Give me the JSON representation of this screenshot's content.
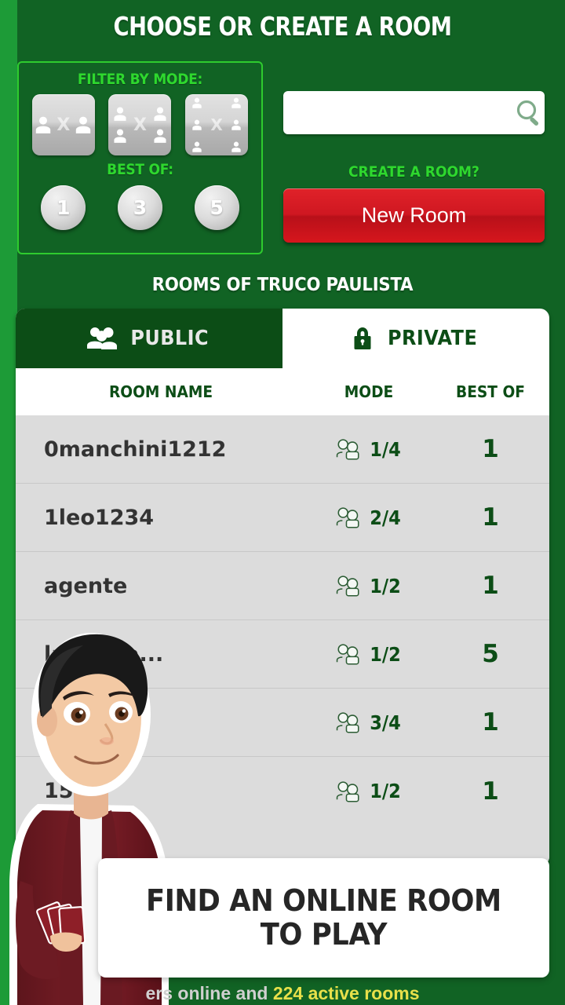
{
  "header": {
    "title": "CHOOSE OR CREATE A ROOM"
  },
  "filter_panel": {
    "mode_label": "FILTER BY MODE:",
    "best_of_label": "BEST OF:",
    "modes": [
      {
        "name": "mode-1v1",
        "players_per_side": 1
      },
      {
        "name": "mode-2v2",
        "players_per_side": 2
      },
      {
        "name": "mode-3v3",
        "players_per_side": 3
      }
    ],
    "best_of_options": [
      "1",
      "3",
      "5"
    ]
  },
  "search": {
    "value": "",
    "placeholder": "",
    "icon": "search-icon"
  },
  "create": {
    "question_label": "CREATE A ROOM?",
    "button_label": "New Room"
  },
  "section": {
    "title": "ROOMS OF TRUCO PAULISTA"
  },
  "tabs": [
    {
      "label": "PUBLIC",
      "icon": "people-icon",
      "active": true
    },
    {
      "label": "PRIVATE",
      "icon": "lock-icon",
      "active": false
    }
  ],
  "table": {
    "columns": [
      "ROOM NAME",
      "MODE",
      "BEST OF"
    ],
    "rows": [
      {
        "name": "0manchini1212",
        "mode": "1/4",
        "best_of": "1"
      },
      {
        "name": "1leo1234",
        "mode": "2/4",
        "best_of": "1"
      },
      {
        "name": "agente",
        "mode": "1/2",
        "best_of": "1"
      },
      {
        "name": "laminha...",
        "mode": "1/2",
        "best_of": "5"
      },
      {
        "name": "",
        "mode": "3/4",
        "best_of": "1"
      },
      {
        "name": "1545",
        "mode": "1/2",
        "best_of": "1"
      }
    ]
  },
  "tooltip": {
    "line1": "FIND AN ONLINE ROOM",
    "line2": "TO PLAY"
  },
  "status": {
    "prefix": "ers online and ",
    "rooms_count": "224",
    "suffix": " active rooms"
  },
  "colors": {
    "background_green": "#116324",
    "accent_green": "#2ed82e",
    "dark_green": "#0c4d16",
    "red_button": "#cf1721",
    "row_bg": "#dcdcdc",
    "status_number": "#e8e04a"
  }
}
